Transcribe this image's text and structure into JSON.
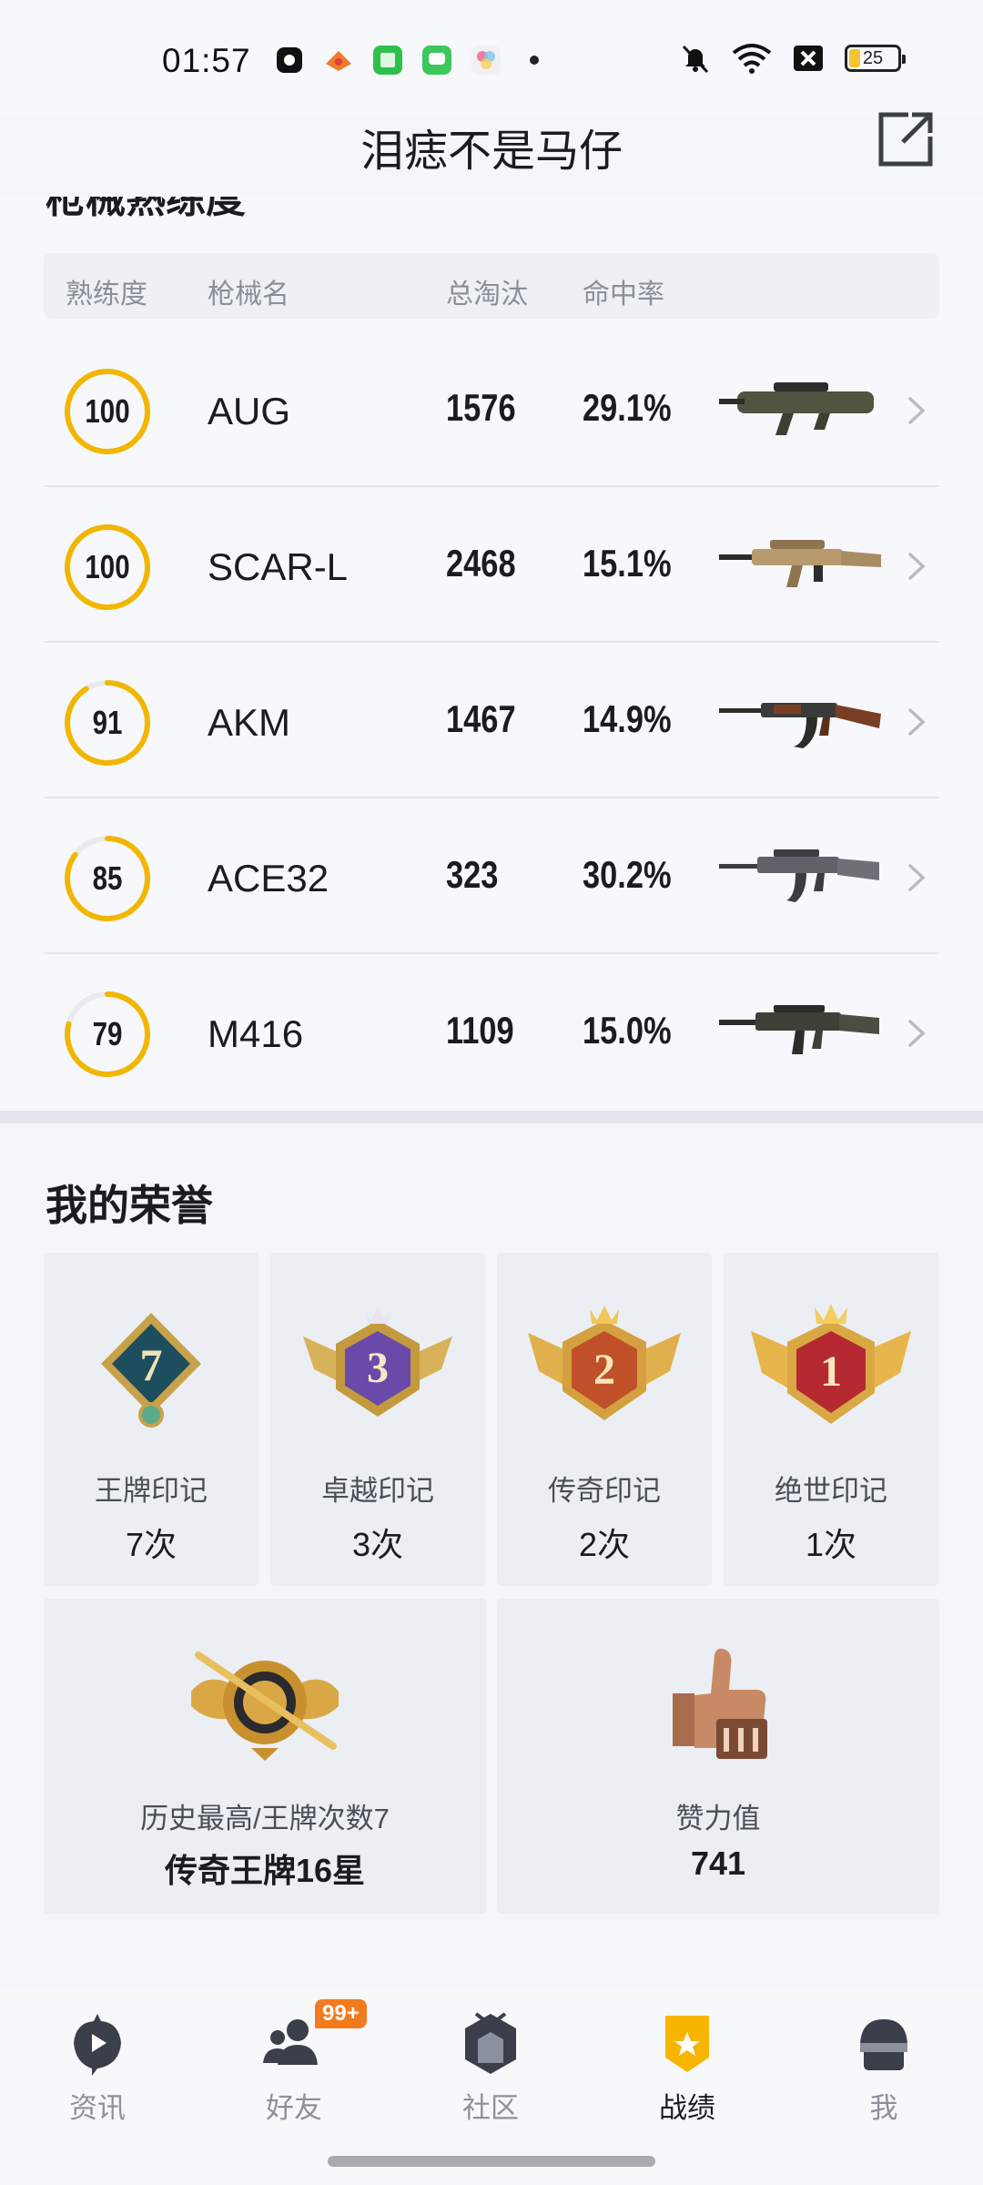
{
  "status_bar": {
    "time": "01:57",
    "battery": "25"
  },
  "header": {
    "title": "泪痣不是马仔"
  },
  "weapons": {
    "cut_title": "枪械熟练度",
    "columns": [
      "熟练度",
      "枪械名",
      "总淘汰",
      "命中率"
    ],
    "rows": [
      {
        "proficiency": 100,
        "name": "AUG",
        "eliminations": "1576",
        "accuracy": "29.1%"
      },
      {
        "proficiency": 100,
        "name": "SCAR-L",
        "eliminations": "2468",
        "accuracy": "15.1%"
      },
      {
        "proficiency": 91,
        "name": "AKM",
        "eliminations": "1467",
        "accuracy": "14.9%"
      },
      {
        "proficiency": 85,
        "name": "ACE32",
        "eliminations": "323",
        "accuracy": "30.2%"
      },
      {
        "proficiency": 79,
        "name": "M416",
        "eliminations": "1109",
        "accuracy": "15.0%"
      }
    ]
  },
  "honors": {
    "title": "我的荣誉",
    "marks": [
      {
        "label": "王牌印记",
        "count": "7次",
        "level": "7"
      },
      {
        "label": "卓越印记",
        "count": "3次",
        "level": "3"
      },
      {
        "label": "传奇印记",
        "count": "2次",
        "level": "2"
      },
      {
        "label": "绝世印记",
        "count": "1次",
        "level": "1"
      }
    ],
    "highest": {
      "label": "历史最高/王牌次数7",
      "value": "传奇王牌16星"
    },
    "likes": {
      "label": "赞力值",
      "value": "741"
    }
  },
  "nav": {
    "items": [
      {
        "label": "资讯",
        "icon": "news-icon"
      },
      {
        "label": "好友",
        "icon": "friends-icon"
      },
      {
        "label": "社区",
        "icon": "community-icon"
      },
      {
        "label": "战绩",
        "icon": "record-icon"
      },
      {
        "label": "我",
        "icon": "me-icon"
      }
    ],
    "friends_badge": "99+",
    "active": "战绩"
  },
  "colors": {
    "accent": "#f2b600",
    "ring_track": "#e8eaee",
    "badge": "#f47a1e"
  }
}
